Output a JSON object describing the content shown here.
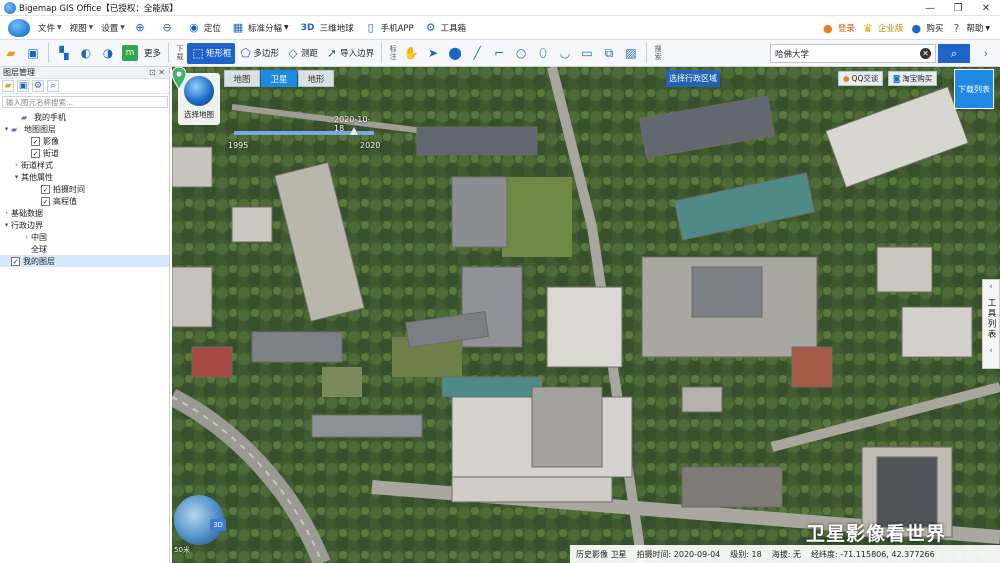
{
  "window": {
    "title": "Bigemap GIS Office【已授权：全能版】",
    "controls": [
      "—",
      "❐",
      "✕"
    ]
  },
  "menubar": {
    "menus": [
      "文件",
      "视图",
      "设置"
    ],
    "buttons": [
      {
        "icon": "zoom-in-icon",
        "label": ""
      },
      {
        "icon": "zoom-out-icon",
        "label": ""
      },
      {
        "icon": "location-icon",
        "label": "定位"
      },
      {
        "icon": "grid-icon",
        "label": "标准分幅"
      },
      {
        "icon": "3d-icon",
        "label": "三维地球"
      },
      {
        "icon": "phone-icon",
        "label": "手机APP"
      },
      {
        "icon": "gear-icon",
        "label": "工具箱"
      }
    ],
    "right": [
      {
        "icon": "user-icon",
        "label": "登录"
      },
      {
        "icon": "crown-icon",
        "label": "企业版"
      },
      {
        "icon": "cart-icon",
        "label": "购买"
      },
      {
        "icon": "help-icon",
        "label": "帮助"
      }
    ]
  },
  "toolbar": {
    "more_label": "更多",
    "download_label": "下载",
    "mark_label": "标注",
    "search_label": "搜索",
    "tools": [
      {
        "icon": "rectangle-select-icon",
        "label": "矩形框"
      },
      {
        "icon": "polygon-icon",
        "label": "多边形"
      },
      {
        "icon": "measure-icon",
        "label": "测距"
      },
      {
        "icon": "import-boundary-icon",
        "label": "导入边界"
      }
    ],
    "search_value": "哈佛大学"
  },
  "sidebar": {
    "title": "图层管理",
    "filter_placeholder": "输入图元名称搜索...",
    "tree": [
      {
        "label": "我的手机",
        "level": 1,
        "expand": "",
        "checkbox": false,
        "folder": true
      },
      {
        "label": "地图图层",
        "level": 0,
        "expand": "▾",
        "checkbox": false,
        "folder": true
      },
      {
        "label": "影像",
        "level": 2,
        "expand": "",
        "checkbox": true,
        "checked": true
      },
      {
        "label": "街道",
        "level": 2,
        "expand": "",
        "checkbox": true,
        "checked": true
      },
      {
        "label": "街道样式",
        "level": 1,
        "expand": "›",
        "checkbox": false
      },
      {
        "label": "其他属性",
        "level": 1,
        "expand": "▾",
        "checkbox": false
      },
      {
        "label": "拍摄时间",
        "level": 3,
        "expand": "",
        "checkbox": true,
        "checked": true
      },
      {
        "label": "高程值",
        "level": 3,
        "expand": "",
        "checkbox": true,
        "checked": true
      },
      {
        "label": "基础数据",
        "level": 0,
        "expand": "›",
        "checkbox": false
      },
      {
        "label": "行政边界",
        "level": 0,
        "expand": "▾",
        "checkbox": false
      },
      {
        "label": "中国",
        "level": 2,
        "expand": "›",
        "checkbox": false
      },
      {
        "label": "全球",
        "level": 2,
        "expand": "",
        "checkbox": false
      },
      {
        "label": "我的图层",
        "level": 0,
        "expand": "",
        "checkbox": true,
        "checked": true,
        "selected": true
      }
    ]
  },
  "map": {
    "select_map_label": "选择地图",
    "tabs": [
      {
        "label": "地图",
        "active": false
      },
      {
        "label": "卫星",
        "active": true
      },
      {
        "label": "地形",
        "active": false
      }
    ],
    "timeline": {
      "date": "2020-10-18",
      "start": "1995",
      "end": "2020",
      "progress": 0.86
    },
    "region_button": "选择行政区域",
    "qq_button": "QQ交谈",
    "taobao_button": "淘宝购买",
    "download_list": "下载列表",
    "tool_list": "工具列表",
    "mini_globe_3d": "3D",
    "scale_text": "50米",
    "watermark": "卫星影像看世界"
  },
  "status": {
    "imagery": "历史影像 卫星",
    "capture_time": "拍摄时间: 2020-09-04",
    "level": "级别: 18",
    "elevation": "海拔: 无",
    "coords": "经纬度: -71.115806, 42.377266"
  },
  "colors": {
    "accent": "#1e63c8",
    "tab_active": "#1e88e5",
    "pin": "#3cb371"
  }
}
